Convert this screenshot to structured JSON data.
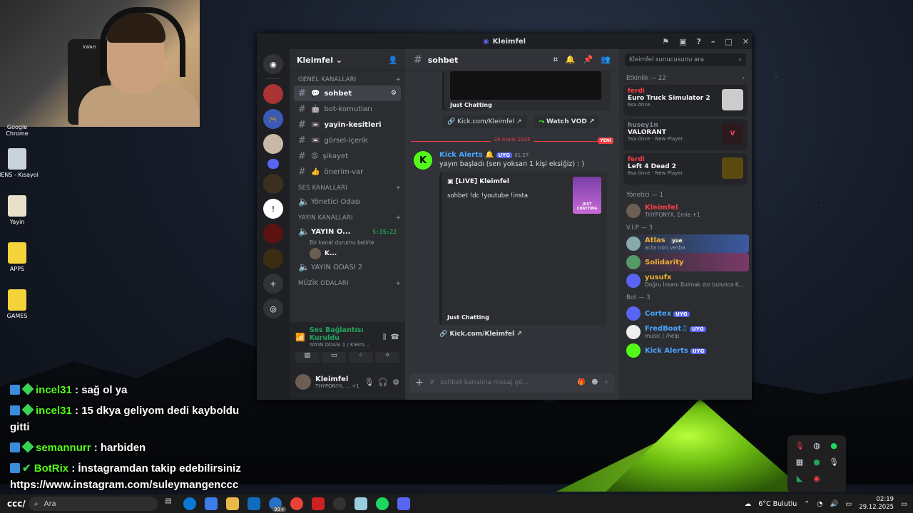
{
  "webcam": {
    "logo_text": "XWAH"
  },
  "desktop_icons": [
    {
      "label": "Google Chrome"
    },
    {
      "label": "TIENS - Kısayol"
    },
    {
      "label": "Yayin"
    },
    {
      "label": "APPS"
    },
    {
      "label": "GAMES"
    }
  ],
  "stream_chat": [
    {
      "user": "incel31",
      "text": ": sağ ol ya"
    },
    {
      "user": "incel31",
      "text": ": 15 dkya geliyom dedi kayboldu gitti"
    },
    {
      "user": "semannurr",
      "text": ": harbiden"
    },
    {
      "user": "BotRix",
      "text": ": İnstagramdan takip edebilirsiniz https://www.instagram.com/suleymangenccc"
    }
  ],
  "discord": {
    "window_title": "Kleimfel",
    "server_name": "Kleimfel",
    "categories": {
      "genel": "GENEL KANALLARI",
      "ses": "SES KANALLARI",
      "yayin": "YAYIN KANALLARI",
      "muzik": "MÜZİK ODALARI"
    },
    "channels": [
      {
        "name": "sohbet",
        "icon": "💬"
      },
      {
        "name": "bot-komutları",
        "icon": "🤖"
      },
      {
        "name": "yayin-kesitleri",
        "icon": "📼"
      },
      {
        "name": "görsel-içerik",
        "icon": "📼"
      },
      {
        "name": "şikayet",
        "icon": "😡"
      },
      {
        "name": "önerim-var",
        "icon": "👍"
      }
    ],
    "voice_channels": {
      "yonetici": "Yönetici Odası",
      "yayin1": "YAYIN O...",
      "yayin1_time": "5:35:22",
      "yayin1_status": "Bir kanal durumu belirle",
      "yayin1_user": "K...",
      "yayin2": "YAYIN ODASI 2"
    },
    "voice_connection": {
      "status": "Ses Bağlantısı Kuruldu",
      "detail": "YAYIN ODASI 1 / Kleim..."
    },
    "user": {
      "name": "Kleimfel",
      "status": "THYPONYX, ... +1"
    },
    "main": {
      "channel": "sohbet",
      "prev_embed_label": "Just Chatting",
      "prev_link": "Kick.com/Kleimfel",
      "watch_vod": "Watch VOD",
      "date_divider": "29 Aralık 2025",
      "new_badge": "YENİ",
      "message": {
        "author": "Kick Alerts",
        "tag": "UYG",
        "time": "01:27",
        "text": "yayın başladı (sen yoksan 1 kişi eksiğiz) : )",
        "embed_title": "[LIVE] Kleimfel",
        "embed_desc": "sohbet !dc !youtube !insta",
        "embed_thumb_label": "JUST CHATTING",
        "embed_footer": "Just Chatting",
        "link": "Kick.com/Kleimfel"
      },
      "input_placeholder": "sohbet kanalına mesaj gö..."
    },
    "members": {
      "search_placeholder": "Kleimfel sunucusunu ara",
      "activity_header": "Etkinlik — 22",
      "activities": [
        {
          "user": "ferdi",
          "game": "Euro Truck Simulator 2",
          "time": "6sa önce",
          "extra": ""
        },
        {
          "user": "husey1n",
          "game": "VALORANT",
          "time": "5sa önce",
          "extra": "New Player"
        },
        {
          "user": "ferdi",
          "game": "Left 4 Dead 2",
          "time": "6sa önce",
          "extra": "New Player"
        }
      ],
      "yonetici_header": "Yönetici — 1",
      "yonetici": [
        {
          "name": "Kleimfel",
          "sub": "THYPONYX, Emie +1"
        }
      ],
      "vip_header": "V.I.P — 3",
      "vip": [
        {
          "name": "Atlas",
          "sub": "acta non verba",
          "tag": "yue"
        },
        {
          "name": "Solidarity",
          "sub": ""
        },
        {
          "name": "yusufx",
          "sub": "Doğru İnsanı Bulmak zor bulunca K..."
        }
      ],
      "bot_header": "Bot — 3",
      "bots": [
        {
          "name": "Cortex",
          "sub": ""
        },
        {
          "name": "FredBoat♫",
          "sub": "music | /help"
        },
        {
          "name": "Kick Alerts",
          "sub": ""
        }
      ],
      "uyg": "UYG"
    }
  },
  "taskbar": {
    "left_label": "ccc/",
    "search": "Ara",
    "badge": "99+",
    "weather": "6°C  Bulutlu",
    "time": "02:19",
    "date": "29.12.2025"
  },
  "colors": {
    "discord_bg": "#313338",
    "kick_green": "#53fc18",
    "blurple": "#5865f2"
  }
}
